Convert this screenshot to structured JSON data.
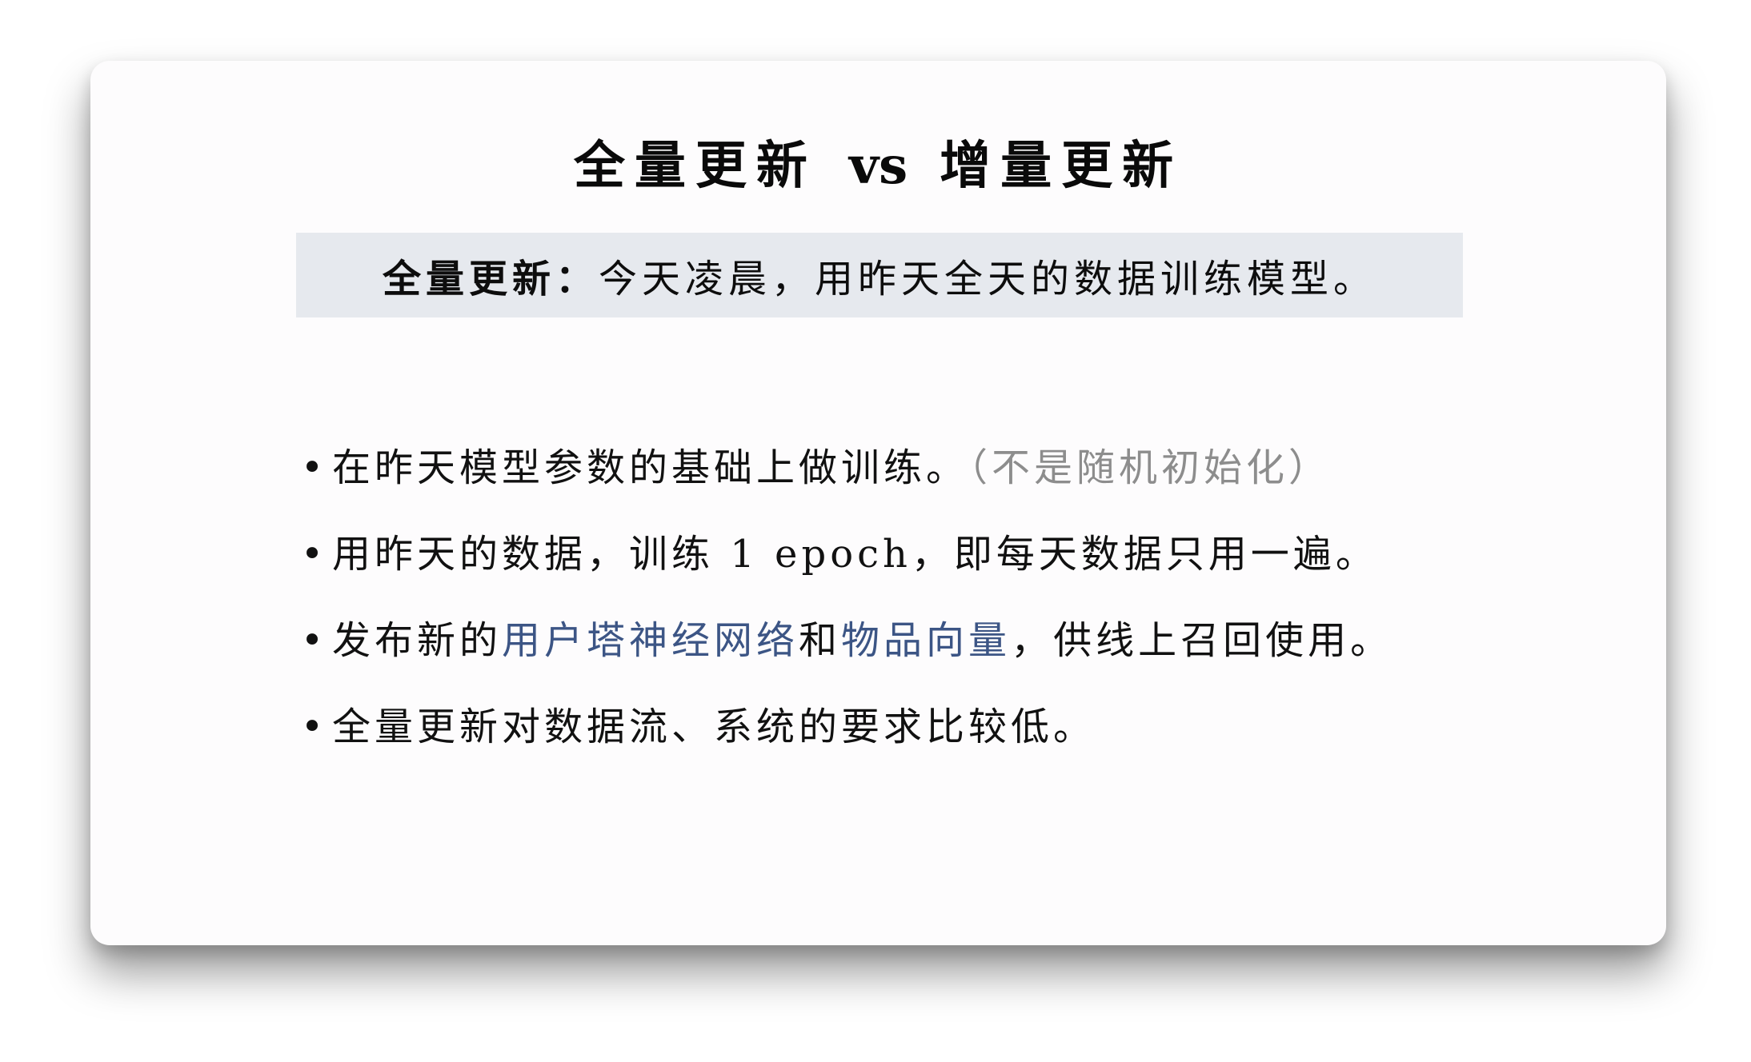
{
  "slide": {
    "title_left": "全量更新",
    "title_vs": "vs",
    "title_right": "增量更新",
    "definition": {
      "term": "全量更新：",
      "text": "今天凌晨，用昨天全天的数据训练模型。"
    },
    "bullet_glyph": "•",
    "bullets": [
      {
        "text": "在昨天模型参数的基础上做训练。",
        "note": "（不是随机初始化）"
      },
      {
        "text": "用昨天的数据，训练 1 epoch，即每天数据只用一遍。"
      },
      {
        "prefix": "发布新的",
        "highlight_1": "用户塔神经网络",
        "middle": "和",
        "highlight_2": "物品向量",
        "suffix": "，供线上召回使用。"
      },
      {
        "text": "全量更新对数据流、系统的要求比较低。"
      }
    ]
  },
  "colors": {
    "background": "#fdfcfd",
    "definition_box": "#e6e9ee",
    "highlight_text": "#3c5585",
    "muted_text": "#8d8d8d"
  }
}
